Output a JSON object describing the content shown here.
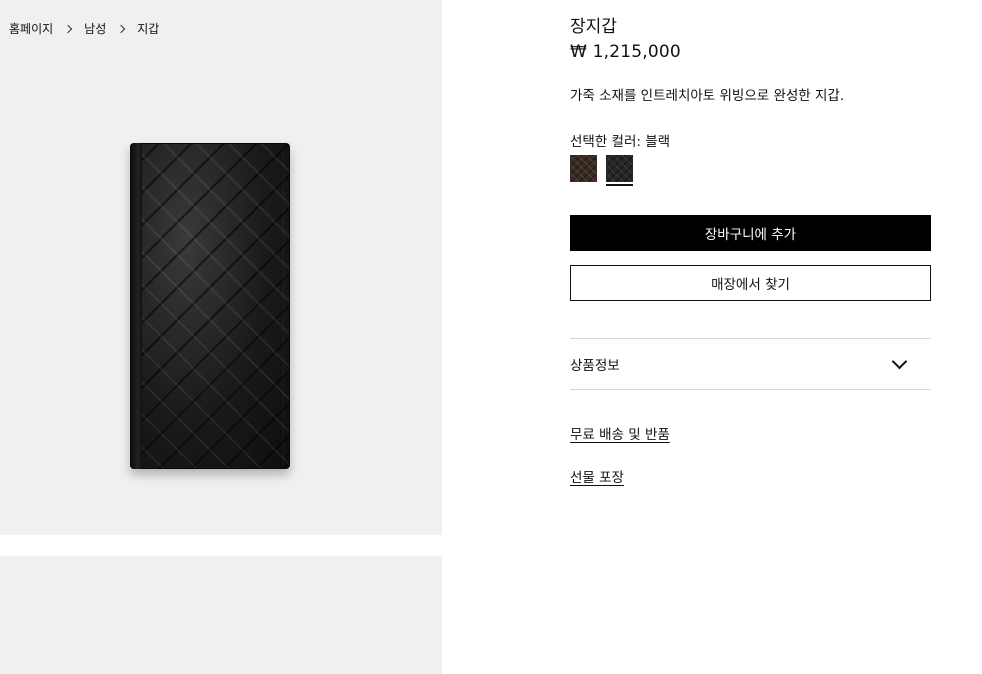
{
  "breadcrumb": {
    "items": [
      "홈페이지",
      "남성",
      "지갑"
    ]
  },
  "product": {
    "title": "장지갑",
    "price": "₩ 1,215,000",
    "description": "가죽 소재를 인트레치아토 위빙으로 완성한 지갑.",
    "color_label": "선택한 컬러: 블랙",
    "swatches": [
      {
        "name": "brown",
        "color": "#3a2a22",
        "selected": false
      },
      {
        "name": "black",
        "color": "#262626",
        "selected": true
      }
    ]
  },
  "actions": {
    "add_to_bag": "장바구니에 추가",
    "find_in_store": "매장에서 찾기"
  },
  "details": {
    "accordion_label": "상품정보",
    "links": [
      "무료 배송 및 반품",
      "선물 포장"
    ]
  },
  "colors": {
    "gallery_bg": "#eff1f0",
    "primary_button": "#000000",
    "divider": "#d6d6d6"
  }
}
